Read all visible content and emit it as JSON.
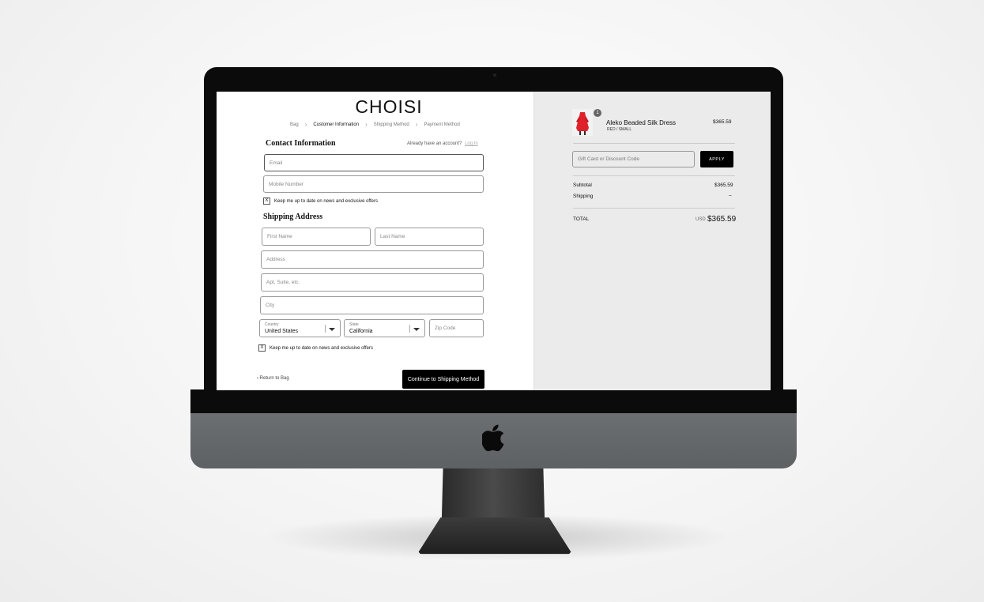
{
  "brand": {
    "logo": "CHOISI"
  },
  "breadcrumbs": [
    {
      "label": "Bag",
      "active": false
    },
    {
      "label": "Customer Information",
      "active": true
    },
    {
      "label": "Shipping Method",
      "active": false
    },
    {
      "label": "Payment Method",
      "active": false
    }
  ],
  "contact": {
    "title": "Contact Information",
    "account_prompt": "Already have an account?",
    "login_link": "Log In",
    "email_placeholder": "Email",
    "mobile_placeholder": "Mobile Number",
    "newsletter_label": "Keep me up to date on news and exclusive offers",
    "newsletter_mark": "X"
  },
  "shipping": {
    "title": "Shipping Address",
    "first_name_placeholder": "First Name",
    "last_name_placeholder": "Last Name",
    "address_placeholder": "Address",
    "apt_placeholder": "Apt, Suite, etc.",
    "city_placeholder": "City",
    "country_label": "Country",
    "country_value": "United States",
    "state_label": "State",
    "state_value": "California",
    "zip_placeholder": "Zip Code",
    "newsletter_label": "Keep me up to date on news and exclusive offers",
    "newsletter_mark": "X"
  },
  "footer": {
    "return_link": "Return to Bag",
    "continue_button": "Continue to Shipping Method"
  },
  "order": {
    "item": {
      "name": "Aleko Beaded Silk Dress",
      "variant": "RED / SMALL",
      "price": "$365.59",
      "quantity": "1"
    },
    "discount_placeholder": "Gift Card or Discount Code",
    "apply_label": "APPLY",
    "subtotal_label": "Subtotal",
    "subtotal_value": "$365.59",
    "shipping_label": "Shipping",
    "shipping_value": "–",
    "total_label": "TOTAL",
    "total_currency": "USD",
    "total_value": "$365.59"
  },
  "colors": {
    "primary_button": "#000000",
    "summary_background": "#ebebeb",
    "product_accent": "#e0202a"
  }
}
